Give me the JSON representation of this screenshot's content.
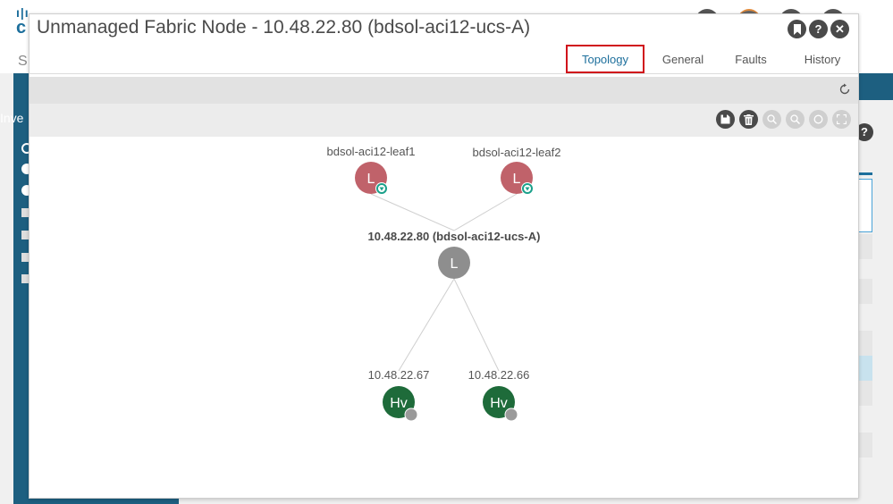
{
  "background": {
    "logo_text": "cisco",
    "sidebar_label": "Inve",
    "header_letter": "S",
    "right_help": "?"
  },
  "modal": {
    "title": "Unmanaged Fabric Node - 10.48.22.80 (bdsol-aci12-ucs-A)",
    "actions": [
      {
        "name": "bookmark",
        "icon": "bookmark-icon"
      },
      {
        "name": "help",
        "icon": "help-icon",
        "glyph": "?"
      },
      {
        "name": "close",
        "icon": "close-icon",
        "glyph": "✕"
      }
    ],
    "tabs": [
      {
        "label": "Topology",
        "active": true
      },
      {
        "label": "General",
        "active": false
      },
      {
        "label": "Faults",
        "active": false
      },
      {
        "label": "History",
        "active": false
      }
    ],
    "toolbar": [
      {
        "name": "save",
        "icon": "save-icon",
        "enabled": true
      },
      {
        "name": "delete",
        "icon": "trash-icon",
        "enabled": true
      },
      {
        "name": "zoom-in",
        "icon": "zoom-in-icon",
        "enabled": false
      },
      {
        "name": "zoom-out",
        "icon": "zoom-out-icon",
        "enabled": false
      },
      {
        "name": "reset",
        "icon": "reset-icon",
        "enabled": false
      },
      {
        "name": "fit",
        "icon": "fit-to-screen-icon",
        "enabled": false
      }
    ]
  },
  "topology": {
    "nodes": [
      {
        "id": "leaf1",
        "label": "bdsol-aci12-leaf1",
        "letter": "L",
        "color": "#c0626a",
        "badge": "shield",
        "badge_color": "#1aa08a",
        "bold": false
      },
      {
        "id": "leaf2",
        "label": "bdsol-aci12-leaf2",
        "letter": "L",
        "color": "#c0626a",
        "badge": "shield",
        "badge_color": "#1aa08a",
        "bold": false
      },
      {
        "id": "ucs",
        "label": "10.48.22.80 (bdsol-aci12-ucs-A)",
        "letter": "L",
        "color": "#8e8e8e",
        "badge": null,
        "bold": true
      },
      {
        "id": "hv1",
        "label": "10.48.22.67",
        "letter": "Hv",
        "color": "#1e6b3a",
        "badge": "status",
        "badge_color": "#9a9a9a",
        "bold": false
      },
      {
        "id": "hv2",
        "label": "10.48.22.66",
        "letter": "Hv",
        "color": "#1e6b3a",
        "badge": "status",
        "badge_color": "#9a9a9a",
        "bold": false
      }
    ],
    "links": [
      {
        "from": "leaf1",
        "to": "ucs"
      },
      {
        "from": "leaf2",
        "to": "ucs"
      },
      {
        "from": "ucs",
        "to": "hv1"
      },
      {
        "from": "ucs",
        "to": "hv2"
      }
    ]
  },
  "colors": {
    "accent": "#1d6f9c",
    "active_tab_border": "#d0121b",
    "nav": "#1d5f80"
  }
}
